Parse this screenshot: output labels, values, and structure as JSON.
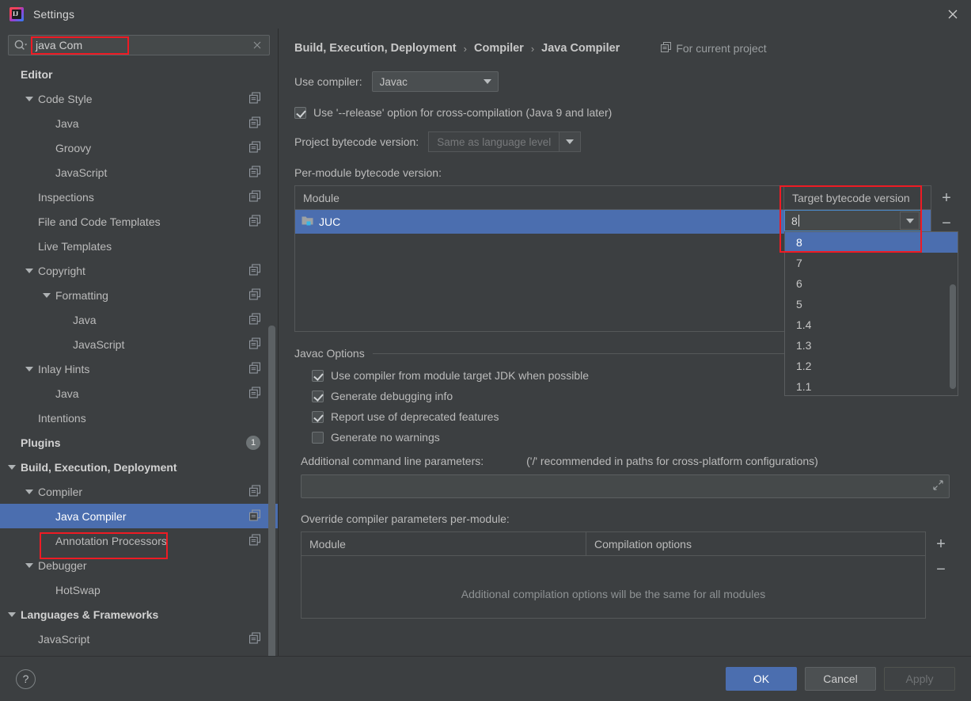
{
  "window": {
    "title": "Settings",
    "logo_icon": "intellij-idea-logo",
    "close_icon": "close-icon"
  },
  "search": {
    "icon": "search-icon",
    "value": "java Com",
    "clear_icon": "close-icon"
  },
  "sidebar": {
    "scrollbar": "vertical-scrollbar",
    "items": [
      {
        "label": "Editor",
        "depth": 0,
        "bold": true,
        "twisty": "none",
        "copy": false,
        "selected": false
      },
      {
        "label": "Code Style",
        "depth": 1,
        "bold": false,
        "twisty": "down",
        "copy": true,
        "selected": false
      },
      {
        "label": "Java",
        "depth": 2,
        "bold": false,
        "twisty": "none",
        "copy": true,
        "selected": false
      },
      {
        "label": "Groovy",
        "depth": 2,
        "bold": false,
        "twisty": "none",
        "copy": true,
        "selected": false
      },
      {
        "label": "JavaScript",
        "depth": 2,
        "bold": false,
        "twisty": "none",
        "copy": true,
        "selected": false
      },
      {
        "label": "Inspections",
        "depth": 1,
        "bold": false,
        "twisty": "none",
        "copy": true,
        "selected": false
      },
      {
        "label": "File and Code Templates",
        "depth": 1,
        "bold": false,
        "twisty": "none",
        "copy": true,
        "selected": false
      },
      {
        "label": "Live Templates",
        "depth": 1,
        "bold": false,
        "twisty": "none",
        "copy": false,
        "selected": false
      },
      {
        "label": "Copyright",
        "depth": 1,
        "bold": false,
        "twisty": "down",
        "copy": true,
        "selected": false
      },
      {
        "label": "Formatting",
        "depth": 2,
        "bold": false,
        "twisty": "down",
        "copy": true,
        "selected": false
      },
      {
        "label": "Java",
        "depth": 3,
        "bold": false,
        "twisty": "none",
        "copy": true,
        "selected": false
      },
      {
        "label": "JavaScript",
        "depth": 3,
        "bold": false,
        "twisty": "none",
        "copy": true,
        "selected": false
      },
      {
        "label": "Inlay Hints",
        "depth": 1,
        "bold": false,
        "twisty": "down",
        "copy": true,
        "selected": false
      },
      {
        "label": "Java",
        "depth": 2,
        "bold": false,
        "twisty": "none",
        "copy": true,
        "selected": false
      },
      {
        "label": "Intentions",
        "depth": 1,
        "bold": false,
        "twisty": "none",
        "copy": false,
        "selected": false
      },
      {
        "label": "Plugins",
        "depth": 0,
        "bold": true,
        "twisty": "none",
        "copy": false,
        "selected": false,
        "badge": "1"
      },
      {
        "label": "Build, Execution, Deployment",
        "depth": 0,
        "bold": true,
        "twisty": "down",
        "copy": false,
        "selected": false
      },
      {
        "label": "Compiler",
        "depth": 1,
        "bold": false,
        "twisty": "down",
        "copy": true,
        "selected": false
      },
      {
        "label": "Java Compiler",
        "depth": 2,
        "bold": false,
        "twisty": "none",
        "copy": true,
        "selected": true
      },
      {
        "label": "Annotation Processors",
        "depth": 2,
        "bold": false,
        "twisty": "none",
        "copy": true,
        "selected": false
      },
      {
        "label": "Debugger",
        "depth": 1,
        "bold": false,
        "twisty": "down",
        "copy": false,
        "selected": false
      },
      {
        "label": "HotSwap",
        "depth": 2,
        "bold": false,
        "twisty": "none",
        "copy": false,
        "selected": false
      },
      {
        "label": "Languages & Frameworks",
        "depth": 0,
        "bold": true,
        "twisty": "down",
        "copy": false,
        "selected": false
      },
      {
        "label": "JavaScript",
        "depth": 1,
        "bold": false,
        "twisty": "none",
        "copy": true,
        "selected": false
      }
    ]
  },
  "main": {
    "breadcrumb": [
      "Build, Execution, Deployment",
      "Compiler",
      "Java Compiler"
    ],
    "breadcrumb_separator": "›",
    "for_current_project": "For current project",
    "for_current_project_icon": "copy-icon",
    "use_compiler_label": "Use compiler:",
    "use_compiler_value": "Javac",
    "release_option_label": "Use '--release' option for cross-compilation (Java 9 and later)",
    "release_option_checked": true,
    "project_bytecode_label": "Project bytecode version:",
    "project_bytecode_value": "Same as language level",
    "per_module_label": "Per-module bytecode version:",
    "module_table": {
      "columns": [
        "Module",
        "Target bytecode version"
      ],
      "rows": [
        {
          "module": "JUC",
          "icon": "module-folder-icon",
          "target": "8",
          "selected": true
        }
      ],
      "add_icon": "plus-icon",
      "remove_icon": "minus-icon"
    },
    "target_dropdown": {
      "editor_value": "8",
      "open": true,
      "options": [
        "8",
        "7",
        "6",
        "5",
        "1.4",
        "1.3",
        "1.2",
        "1.1"
      ],
      "selected_option": "8",
      "arrow_icon": "chevron-down-icon",
      "scrollbar": "vertical-scrollbar"
    },
    "javac_options_title": "Javac Options",
    "javac_options": [
      {
        "label": "Use compiler from module target JDK when possible",
        "checked": true
      },
      {
        "label": "Generate debugging info",
        "checked": true
      },
      {
        "label": "Report use of deprecated features",
        "checked": true
      },
      {
        "label": "Generate no warnings",
        "checked": false
      }
    ],
    "additional_params_label": "Additional command line parameters:",
    "additional_params_hint": "('/' recommended in paths for cross-platform configurations)",
    "additional_params_value": "",
    "additional_params_expand_icon": "expand-icon",
    "override_label": "Override compiler parameters per-module:",
    "override_table": {
      "columns": [
        "Module",
        "Compilation options"
      ],
      "empty_text": "Additional compilation options will be the same for all modules",
      "add_icon": "plus-icon",
      "remove_icon": "minus-icon"
    }
  },
  "footer": {
    "help_label": "?",
    "ok": "OK",
    "cancel": "Cancel",
    "apply": "Apply",
    "apply_disabled": true
  },
  "colors": {
    "window_bg": "#3c3f41",
    "selection_blue": "#4b6eaf",
    "annotation_red": "#ee1b24",
    "focus_border": "#4a88c7",
    "text": "#bbbbbb"
  }
}
